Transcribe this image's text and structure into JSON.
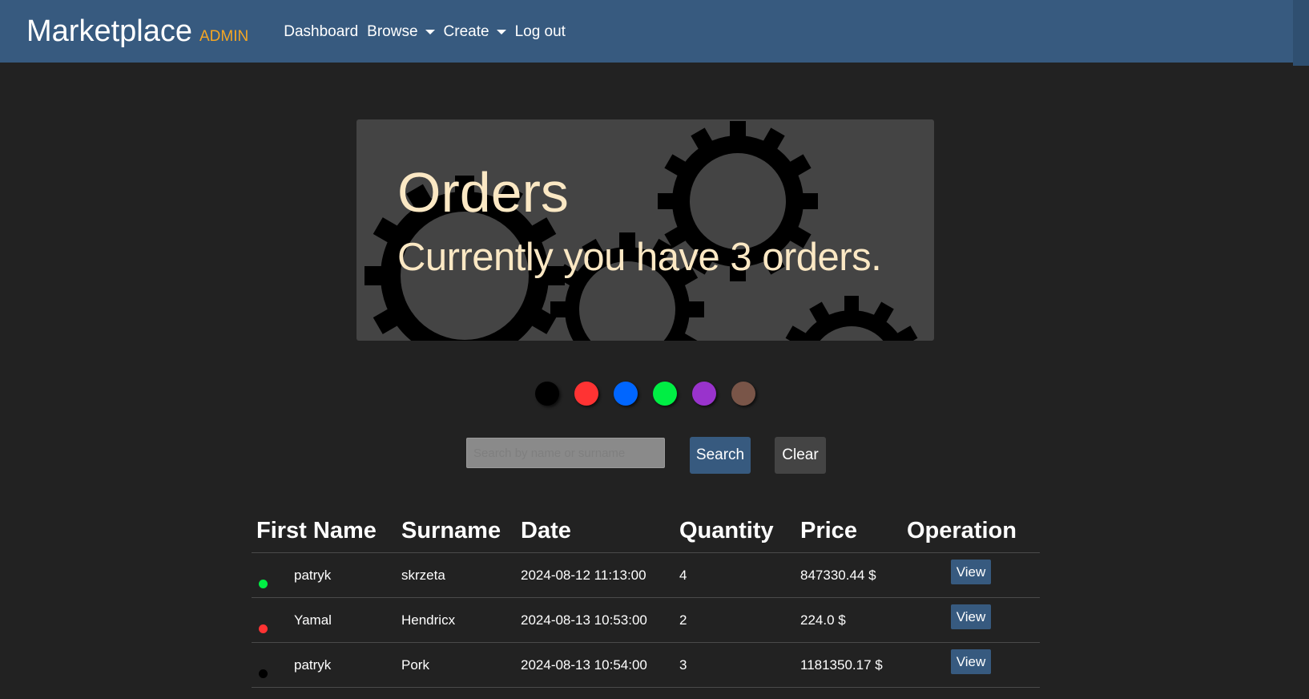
{
  "navbar": {
    "brand": "Marketplace",
    "brand_tag": "ADMIN",
    "links": [
      {
        "label": "Dashboard",
        "dropdown": false
      },
      {
        "label": "Browse",
        "dropdown": true
      },
      {
        "label": "Create",
        "dropdown": true
      },
      {
        "label": "Log out",
        "dropdown": false
      }
    ],
    "background": "#375a7f",
    "tag_color": "#f5a623"
  },
  "hero": {
    "title": "Orders",
    "subtitle": "Currently you have 3 orders.",
    "text_color": "#fbe8c4",
    "background_icon": "gears-icon"
  },
  "color_filters": [
    "#000000",
    "#ff3333",
    "#0066ff",
    "#00ee44",
    "#9933cc",
    "#795548"
  ],
  "search": {
    "placeholder": "Search by name or surname",
    "search_label": "Search",
    "clear_label": "Clear"
  },
  "orders_table": {
    "columns": [
      "First Name",
      "Surname",
      "Date",
      "Quantity",
      "Price",
      "Operation"
    ],
    "rows": [
      {
        "status_color": "#00ee44",
        "first_name": "patryk",
        "surname": "skrzeta",
        "date": "2024-08-12 11:13:00",
        "quantity": "4",
        "price": "847330.44 $",
        "action": "View"
      },
      {
        "status_color": "#ff3333",
        "first_name": "Yamal",
        "surname": "Hendricx",
        "date": "2024-08-13 10:53:00",
        "quantity": "2",
        "price": "224.0 $",
        "action": "View"
      },
      {
        "status_color": "#000000",
        "first_name": "patryk",
        "surname": "Pork",
        "date": "2024-08-13 10:54:00",
        "quantity": "3",
        "price": "1181350.17 $",
        "action": "View"
      }
    ]
  }
}
